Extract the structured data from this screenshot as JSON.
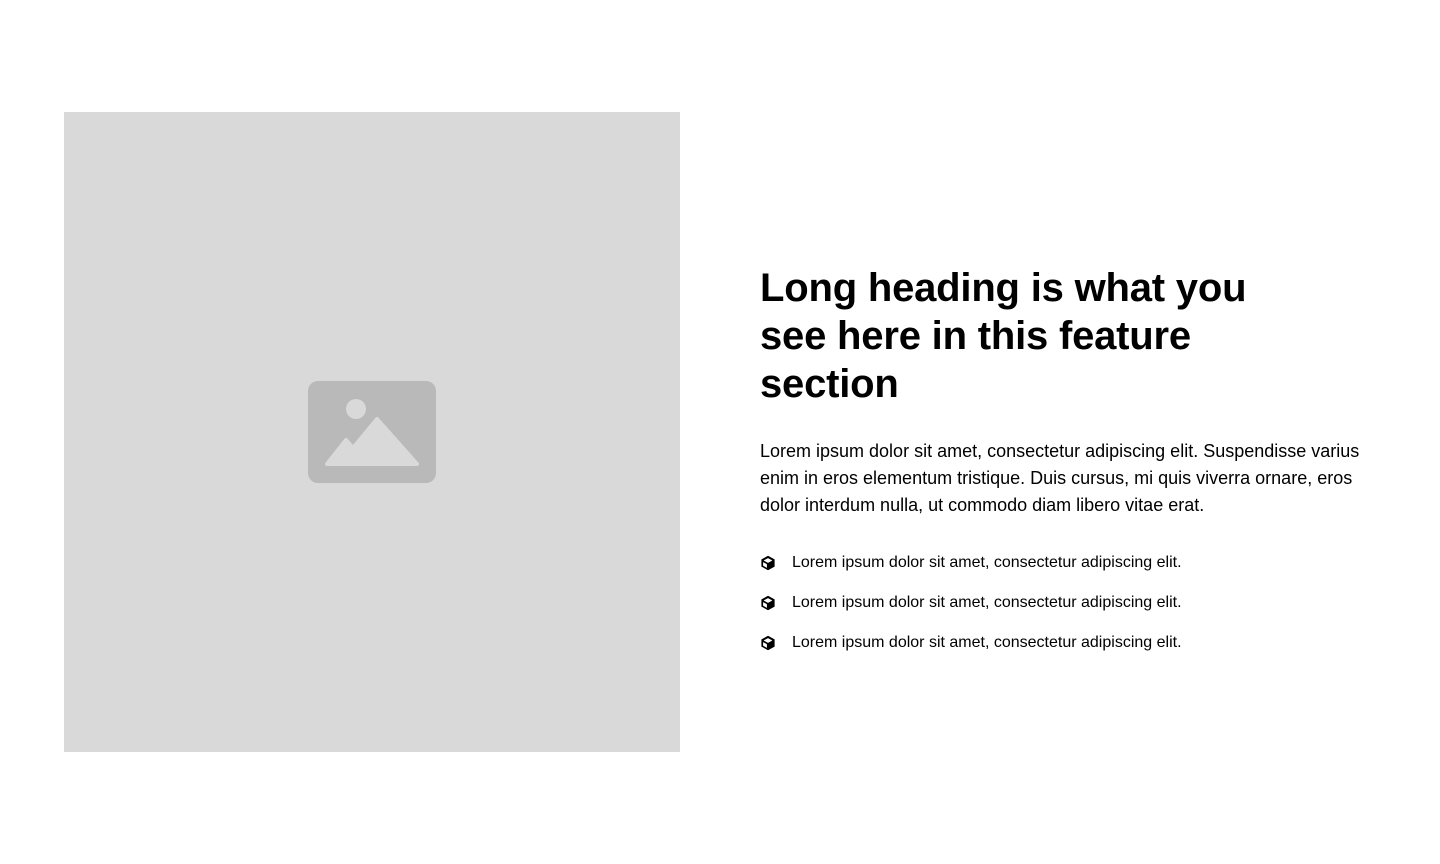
{
  "colors": {
    "background": "#ffffff",
    "placeholder_bg": "#d9d9d9",
    "placeholder_icon": "#b9b9b9",
    "text": "#000000"
  },
  "media": {
    "icon": "image-placeholder-icon"
  },
  "feature": {
    "heading": "Long heading is what you see here in this feature section",
    "paragraph": "Lorem ipsum dolor sit amet, consectetur adipiscing elit. Suspendisse varius enim in eros elementum tristique. Duis cursus, mi quis viverra ornare, eros dolor interdum nulla, ut commodo diam libero vitae erat.",
    "items": [
      {
        "icon": "cube-icon",
        "text": "Lorem ipsum dolor sit amet, consectetur adipiscing elit."
      },
      {
        "icon": "cube-icon",
        "text": "Lorem ipsum dolor sit amet, consectetur adipiscing elit."
      },
      {
        "icon": "cube-icon",
        "text": "Lorem ipsum dolor sit amet, consectetur adipiscing elit."
      }
    ]
  }
}
